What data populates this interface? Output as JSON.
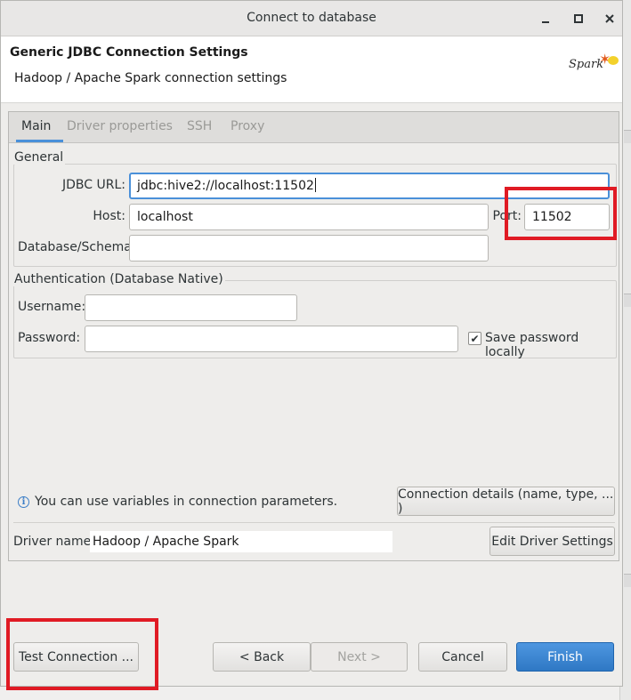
{
  "window": {
    "title": "Connect to database",
    "controls": {
      "minimize": "−",
      "maximize": "▫",
      "close": "×"
    }
  },
  "header": {
    "title": "Generic JDBC Connection Settings",
    "subtitle": "Hadoop / Apache Spark connection settings",
    "logo_text": "Spark"
  },
  "tabs": [
    {
      "label": "Main",
      "active": true
    },
    {
      "label": "Driver properties",
      "active": false
    },
    {
      "label": "SSH",
      "active": false
    },
    {
      "label": "Proxy",
      "active": false
    }
  ],
  "general": {
    "legend": "General",
    "jdbc_url_label": "JDBC URL:",
    "jdbc_url_value": "jdbc:hive2://localhost:11502",
    "host_label": "Host:",
    "host_value": "localhost",
    "port_label": "Port:",
    "port_value": "11502",
    "database_label": "Database/Schema:",
    "database_value": ""
  },
  "auth": {
    "legend": "Authentication (Database Native)",
    "username_label": "Username:",
    "username_value": "",
    "password_label": "Password:",
    "password_value": "",
    "save_password_label": "Save password locally",
    "save_password_checked": true
  },
  "info": {
    "text": "You can use variables in connection parameters.",
    "details_button": "Connection details (name, type, ... )"
  },
  "driver": {
    "label": "Driver name:",
    "value": "Hadoop / Apache Spark",
    "edit_button": "Edit Driver Settings"
  },
  "footer": {
    "test_button": "Test Connection ...",
    "back_button": "< Back",
    "next_button": "Next >",
    "next_enabled": false,
    "cancel_button": "Cancel",
    "finish_button": "Finish"
  },
  "colors": {
    "highlight": "#e01b24",
    "primary_button": "#3582d0",
    "focus": "#4a90d9"
  }
}
